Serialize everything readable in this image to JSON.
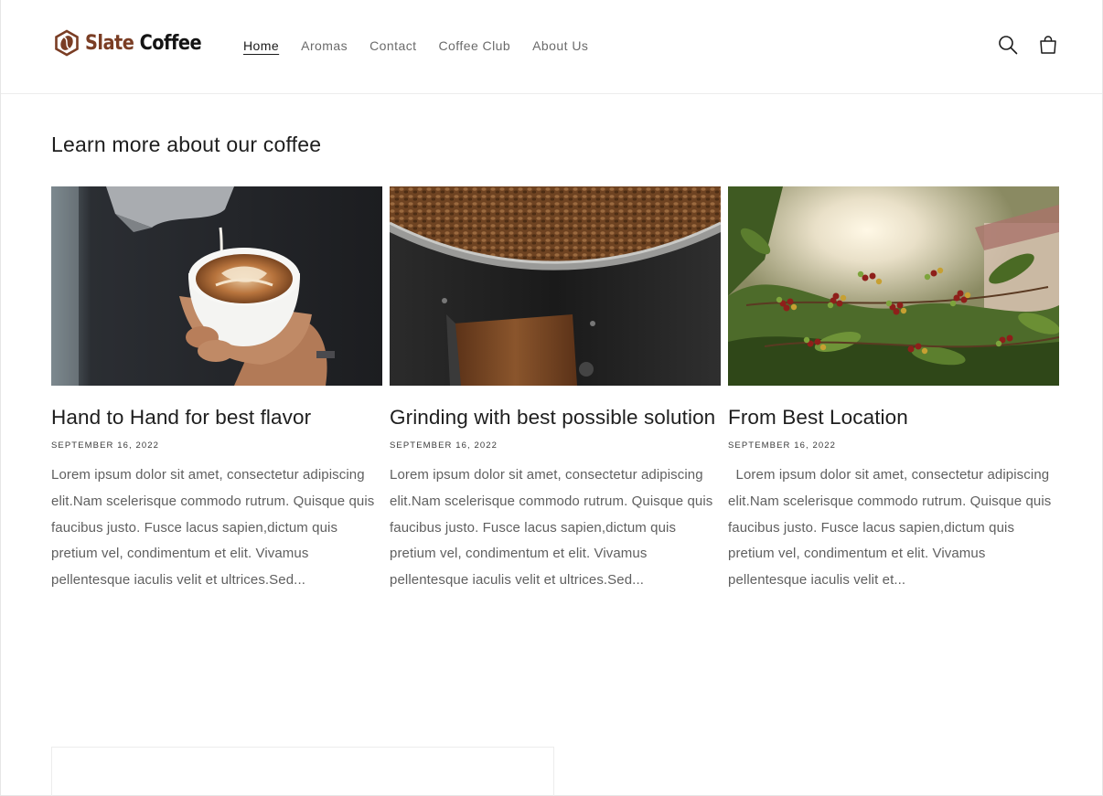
{
  "brand": {
    "name_part1": "Slate",
    "name_part2": "Coffee",
    "colors": {
      "accent": "#7a3d24",
      "text": "#141414"
    }
  },
  "nav": {
    "items": [
      {
        "label": "Home",
        "active": true
      },
      {
        "label": "Aromas",
        "active": false
      },
      {
        "label": "Contact",
        "active": false
      },
      {
        "label": "Coffee Club",
        "active": false
      },
      {
        "label": "About Us",
        "active": false
      }
    ]
  },
  "header_icons": {
    "search": "search-icon",
    "cart": "shopping-bag-icon"
  },
  "section": {
    "title": "Learn more about our coffee"
  },
  "articles": [
    {
      "image": "latte-art-pour-photo",
      "title": "Hand to Hand for best flavor",
      "date": "SEPTEMBER 16, 2022",
      "excerpt": "Lorem ipsum dolor sit amet, consectetur adipiscing elit.Nam scelerisque commodo rutrum. Quisque quis faucibus justo. Fusce lacus sapien,dictum quis pretium vel, condimentum et elit. Vivamus pellentesque iaculis velit et ultrices.Sed..."
    },
    {
      "image": "coffee-roaster-beans-photo",
      "title": "Grinding with best possible solution",
      "date": "SEPTEMBER 16, 2022",
      "excerpt": "Lorem ipsum dolor sit amet, consectetur adipiscing elit.Nam scelerisque commodo rutrum. Quisque quis faucibus justo. Fusce lacus sapien,dictum quis pretium vel, condimentum et elit. Vivamus pellentesque iaculis velit et ultrices.Sed..."
    },
    {
      "image": "coffee-cherries-plant-photo",
      "title": "From Best Location",
      "date": "SEPTEMBER 16, 2022",
      "excerpt": "  Lorem ipsum dolor sit amet, consectetur adipiscing elit.Nam scelerisque commodo rutrum. Quisque quis faucibus justo. Fusce lacus sapien,dictum quis pretium vel, condimentum et elit. Vivamus pellentesque iaculis velit et..."
    }
  ]
}
